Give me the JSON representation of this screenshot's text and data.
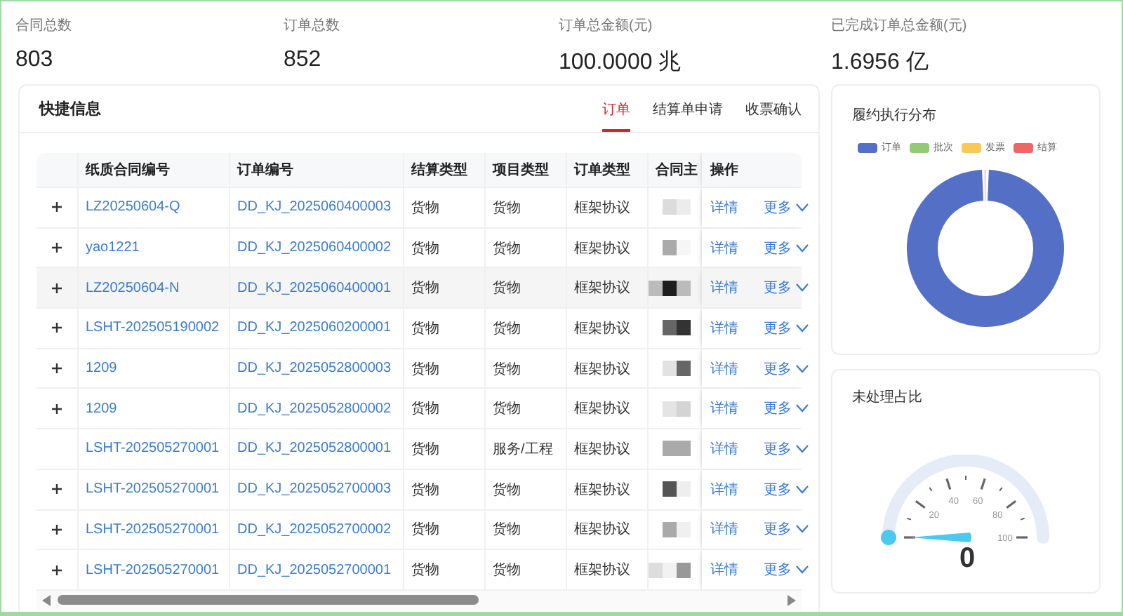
{
  "stats": [
    {
      "label": "合同总数",
      "value": "803"
    },
    {
      "label": "订单总数",
      "value": "852"
    },
    {
      "label": "订单总金额(元)",
      "value": "100.0000 兆"
    },
    {
      "label": "已完成订单总金额(元)",
      "value": "1.6956 亿"
    }
  ],
  "orders_card": {
    "title": "快捷信息",
    "tabs": [
      {
        "label": "订单",
        "selected": true
      },
      {
        "label": "结算单申请",
        "selected": false
      },
      {
        "label": "收票确认",
        "selected": false
      }
    ],
    "table": {
      "columns": [
        "纸质合同编号",
        "订单编号",
        "结算类型",
        "项目类型",
        "订单类型",
        "合同主",
        "操作"
      ],
      "rows": [
        {
          "expandable": true,
          "highlighted": false,
          "paper_contract_no": "LZ20250604-Q",
          "order_no": "DD_KJ_2025060400003",
          "settlement_type": "货物",
          "project_type": "货物",
          "order_type": "框架协议",
          "contract_party": {
            "kind": "redacted"
          },
          "actions": [
            "详情",
            "更多"
          ]
        },
        {
          "expandable": true,
          "highlighted": false,
          "paper_contract_no": "yao1221",
          "order_no": "DD_KJ_2025060400002",
          "settlement_type": "货物",
          "project_type": "货物",
          "order_type": "框架协议",
          "contract_party": {
            "kind": "redacted"
          },
          "actions": [
            "详情",
            "更多"
          ]
        },
        {
          "expandable": true,
          "highlighted": true,
          "paper_contract_no": "LZ20250604-N",
          "order_no": "DD_KJ_2025060400001",
          "settlement_type": "货物",
          "project_type": "货物",
          "order_type": "框架协议",
          "contract_party": {
            "kind": "redacted"
          },
          "actions": [
            "详情",
            "更多"
          ]
        },
        {
          "expandable": true,
          "highlighted": false,
          "paper_contract_no": "LSHT-202505190002",
          "order_no": "DD_KJ_2025060200001",
          "settlement_type": "货物",
          "project_type": "货物",
          "order_type": "框架协议",
          "contract_party": {
            "kind": "redacted"
          },
          "actions": [
            "详情",
            "更多"
          ]
        },
        {
          "expandable": true,
          "highlighted": false,
          "paper_contract_no": "1209",
          "order_no": "DD_KJ_2025052800003",
          "settlement_type": "货物",
          "project_type": "货物",
          "order_type": "框架协议",
          "contract_party": {
            "kind": "redacted"
          },
          "actions": [
            "详情",
            "更多"
          ]
        },
        {
          "expandable": true,
          "highlighted": false,
          "paper_contract_no": "1209",
          "order_no": "DD_KJ_2025052800002",
          "settlement_type": "货物",
          "project_type": "货物",
          "order_type": "框架协议",
          "contract_party": {
            "kind": "redacted"
          },
          "actions": [
            "详情",
            "更多"
          ]
        },
        {
          "expandable": false,
          "highlighted": false,
          "paper_contract_no": "LSHT-202505270001",
          "order_no": "DD_KJ_2025052800001",
          "settlement_type": "货物",
          "project_type": "服务/工程",
          "order_type": "框架协议",
          "contract_party": {
            "kind": "redacted"
          },
          "actions": [
            "详情",
            "更多"
          ]
        },
        {
          "expandable": true,
          "highlighted": false,
          "paper_contract_no": "LSHT-202505270001",
          "order_no": "DD_KJ_2025052700003",
          "settlement_type": "货物",
          "project_type": "货物",
          "order_type": "框架协议",
          "contract_party": {
            "kind": "redacted"
          },
          "actions": [
            "详情",
            "更多"
          ]
        },
        {
          "expandable": true,
          "highlighted": false,
          "paper_contract_no": "LSHT-202505270001",
          "order_no": "DD_KJ_2025052700002",
          "settlement_type": "货物",
          "project_type": "货物",
          "order_type": "框架协议",
          "contract_party": {
            "kind": "redacted"
          },
          "actions": [
            "详情",
            "更多"
          ]
        },
        {
          "expandable": true,
          "highlighted": false,
          "paper_contract_no": "LSHT-202505270001",
          "order_no": "DD_KJ_2025052700001",
          "settlement_type": "货物",
          "project_type": "货物",
          "order_type": "框架协议",
          "contract_party": {
            "kind": "redacted"
          },
          "actions": [
            "详情",
            "更多"
          ]
        }
      ]
    }
  },
  "distribution_card": {
    "title": "履约执行分布",
    "legend": [
      {
        "label": "订单",
        "color": "#5470c6"
      },
      {
        "label": "批次",
        "color": "#91cc75"
      },
      {
        "label": "发票",
        "color": "#fac858"
      },
      {
        "label": "结算",
        "color": "#ee6666"
      }
    ]
  },
  "pending_card": {
    "title": "未处理占比",
    "gauge": {
      "level": 0,
      "tick_labels": [
        "20",
        "40",
        "60",
        "80",
        "100"
      ],
      "value": "0"
    }
  }
}
